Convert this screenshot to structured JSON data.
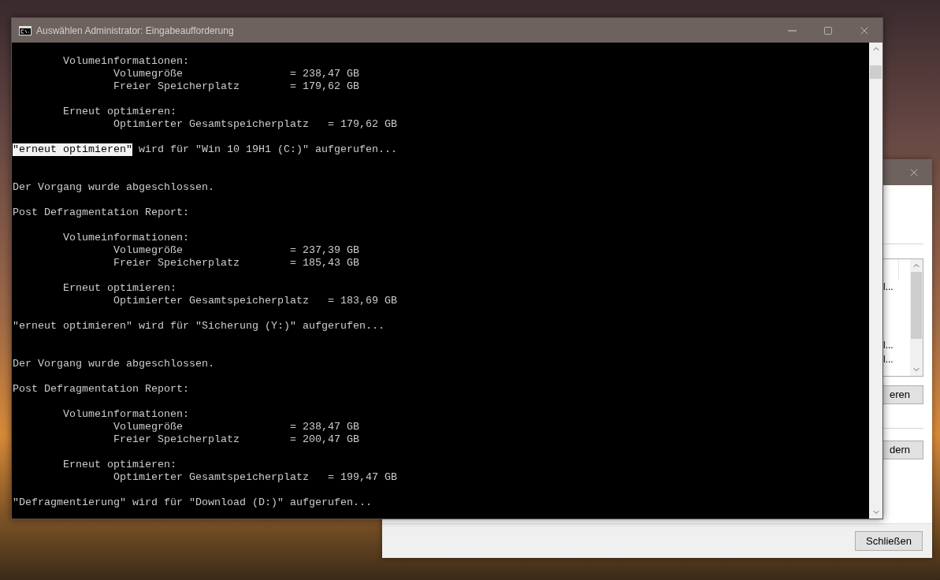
{
  "console_window": {
    "title": "Auswählen Administrator: Eingabeaufforderung",
    "lines": [
      {
        "kind": "group",
        "text": "Volumeinformationen:"
      },
      {
        "kind": "entry",
        "label": "Volumegröße",
        "value": "= 238,47 GB"
      },
      {
        "kind": "entry",
        "label": "Freier Speicherplatz",
        "value": "= 179,62 GB"
      },
      {
        "kind": "blank"
      },
      {
        "kind": "group",
        "text": "Erneut optimieren:"
      },
      {
        "kind": "entry",
        "label": "Optimierter Gesamtspeicherplatz",
        "value": "= 179,62 GB"
      },
      {
        "kind": "blank"
      },
      {
        "kind": "plain",
        "segments": [
          {
            "text": "\"erneut optimieren\"",
            "selected": true
          },
          {
            "text": "wird für \"Win 10 19H1 (C:)\" aufgerufen...",
            "selected": false
          }
        ]
      },
      {
        "kind": "blank"
      },
      {
        "kind": "blank"
      },
      {
        "kind": "plain",
        "segments": [
          {
            "text": "Der Vorgang wurde abgeschlossen.",
            "selected": false
          }
        ]
      },
      {
        "kind": "blank"
      },
      {
        "kind": "plain",
        "segments": [
          {
            "text": "Post Defragmentation Report:",
            "selected": false
          }
        ]
      },
      {
        "kind": "blank"
      },
      {
        "kind": "group",
        "text": "Volumeinformationen:"
      },
      {
        "kind": "entry",
        "label": "Volumegröße",
        "value": "= 237,39 GB"
      },
      {
        "kind": "entry",
        "label": "Freier Speicherplatz",
        "value": "= 185,43 GB"
      },
      {
        "kind": "blank"
      },
      {
        "kind": "group",
        "text": "Erneut optimieren:"
      },
      {
        "kind": "entry",
        "label": "Optimierter Gesamtspeicherplatz",
        "value": "= 183,69 GB"
      },
      {
        "kind": "blank"
      },
      {
        "kind": "plain",
        "segments": [
          {
            "text": "\"erneut optimieren\" wird für \"Sicherung (Y:)\" aufgerufen...",
            "selected": false
          }
        ]
      },
      {
        "kind": "blank"
      },
      {
        "kind": "blank"
      },
      {
        "kind": "plain",
        "segments": [
          {
            "text": "Der Vorgang wurde abgeschlossen.",
            "selected": false
          }
        ]
      },
      {
        "kind": "blank"
      },
      {
        "kind": "plain",
        "segments": [
          {
            "text": "Post Defragmentation Report:",
            "selected": false
          }
        ]
      },
      {
        "kind": "blank"
      },
      {
        "kind": "group",
        "text": "Volumeinformationen:"
      },
      {
        "kind": "entry",
        "label": "Volumegröße",
        "value": "= 238,47 GB"
      },
      {
        "kind": "entry",
        "label": "Freier Speicherplatz",
        "value": "= 200,47 GB"
      },
      {
        "kind": "blank"
      },
      {
        "kind": "group",
        "text": "Erneut optimieren:"
      },
      {
        "kind": "entry",
        "label": "Optimierter Gesamtspeicherplatz",
        "value": "= 199,47 GB"
      },
      {
        "kind": "blank"
      },
      {
        "kind": "plain",
        "segments": [
          {
            "text": "\"Defragmentierung\" wird für \"Download (D:)\" aufgerufen...",
            "selected": false
          }
        ]
      }
    ]
  },
  "background_dialog": {
    "list_rows": [
      {
        "text": "l..."
      },
      {
        "text": "l..."
      },
      {
        "text": "l..."
      }
    ],
    "buttons": [
      "eren",
      "dern"
    ],
    "close_button": "Schließen"
  }
}
